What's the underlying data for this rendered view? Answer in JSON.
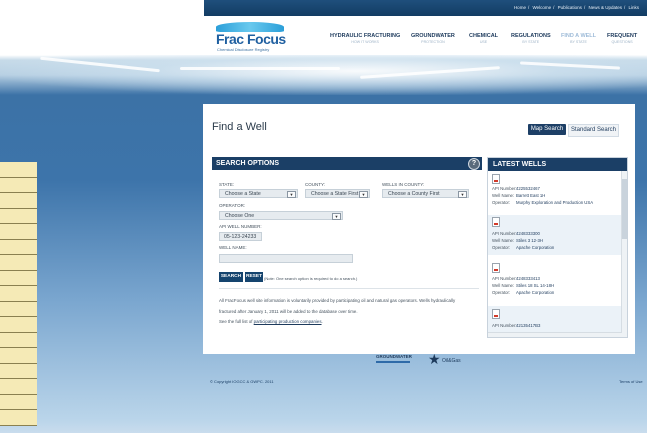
{
  "top_links": [
    "Home",
    "Welcome",
    "Publications",
    "News & Updates",
    "Links"
  ],
  "brand": {
    "name": "Frac Focus",
    "tagline": "Chemical Disclosure Registry"
  },
  "nav": [
    {
      "label": "HYDRAULIC FRACTURING",
      "sub": "HOW IT WORKS"
    },
    {
      "label": "GROUNDWATER",
      "sub": "PROTECTION"
    },
    {
      "label": "CHEMICAL",
      "sub": "USE"
    },
    {
      "label": "REGULATIONS",
      "sub": "BY STATE"
    },
    {
      "label": "FIND A WELL",
      "sub": "BY STATE"
    },
    {
      "label": "FREQUENT",
      "sub": "QUESTIONS"
    }
  ],
  "page_title": "Find a Well",
  "search_modes": {
    "map": "Map Search",
    "standard": "Standard Search"
  },
  "search": {
    "heading": "SEARCH OPTIONS",
    "help": "?",
    "state_label": "STATE:",
    "state_value": "Choose a State",
    "county_label": "COUNTY:",
    "county_value": "Choose a State First",
    "wells_label": "WELLS IN COUNTY:",
    "wells_value": "Choose a County First",
    "operator_label": "OPERATOR:",
    "operator_value": "Choose One",
    "api_label": "API WELL NUMBER:",
    "api_value": "05-123-24233",
    "wellname_label": "WELL NAME:",
    "wellname_value": "",
    "search_button": "SEARCH",
    "reset_button": "RESET",
    "note": "(Note: One search option is required to do a search.)",
    "info_line1": "All FracFocus well site information is voluntarily provided by participating oil and natural gas operators. Wells hydraulically",
    "info_line2": "fractured after January 1, 2011 will be added to the database over time.",
    "list_prefix": "See the full list of",
    "list_link": "participating production companies",
    "list_suffix": "."
  },
  "latest": {
    "heading": "LATEST WELLS",
    "api_label": "API Number:",
    "name_label": "Well Name:",
    "operator_label": "Operator:",
    "wells": [
      {
        "api": "4225532467",
        "name": "Barrett East 1H",
        "operator": "Murphy Exploration and Production USA"
      },
      {
        "api": "4248333300",
        "name": "Stiles 3 12-3H",
        "operator": "Apache Corporation"
      },
      {
        "api": "4248333413",
        "name": "Stiles 18 SL 14-18H",
        "operator": "Apache Corporation"
      },
      {
        "api": "42135417B3",
        "name": "",
        "operator": ""
      }
    ]
  },
  "footer": {
    "partner1": "GROUNDWATER",
    "partner2": "Oil&Gas",
    "copyright": "© Copyright IOGCC & GWPC. 2011",
    "terms": "Terms of Use"
  }
}
